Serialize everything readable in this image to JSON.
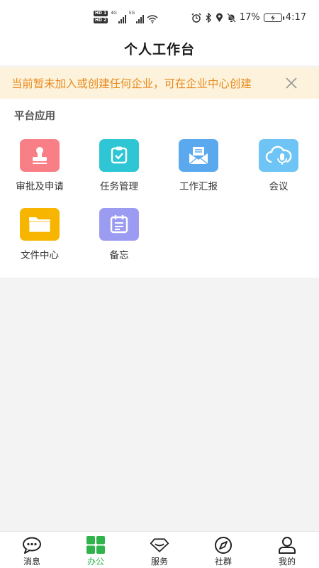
{
  "status_bar": {
    "hd1": "HD 1",
    "hd2": "HD 2",
    "net1": "4G",
    "net2": "5G",
    "battery_percent": "17%",
    "time": "4:17"
  },
  "header": {
    "title": "个人工作台"
  },
  "notice": {
    "text": "当前暂未加入或创建任何企业，可在企业中心创建",
    "color": "#e88a1e",
    "background": "#fdf3dc"
  },
  "platform_apps": {
    "section_title": "平台应用",
    "items": [
      {
        "label": "审批及申请",
        "icon": "stamp-icon",
        "color": "#f97f86"
      },
      {
        "label": "任务管理",
        "icon": "clipboard-check-icon",
        "color": "#2ec6d4"
      },
      {
        "label": "工作汇报",
        "icon": "envelope-icon",
        "color": "#5aa9ef"
      },
      {
        "label": "会议",
        "icon": "cloud-mic-icon",
        "color": "#6ec4f4"
      },
      {
        "label": "文件中心",
        "icon": "folder-icon",
        "color": "#f7b500"
      },
      {
        "label": "备忘",
        "icon": "calendar-note-icon",
        "color": "#9b9bf2"
      }
    ]
  },
  "bottom_nav": {
    "active_color": "#2fb34a",
    "items": [
      {
        "label": "消息",
        "icon": "chat-icon"
      },
      {
        "label": "办公",
        "icon": "grid-icon",
        "active": true
      },
      {
        "label": "服务",
        "icon": "diamond-icon"
      },
      {
        "label": "社群",
        "icon": "compass-icon"
      },
      {
        "label": "我的",
        "icon": "person-icon"
      }
    ]
  }
}
